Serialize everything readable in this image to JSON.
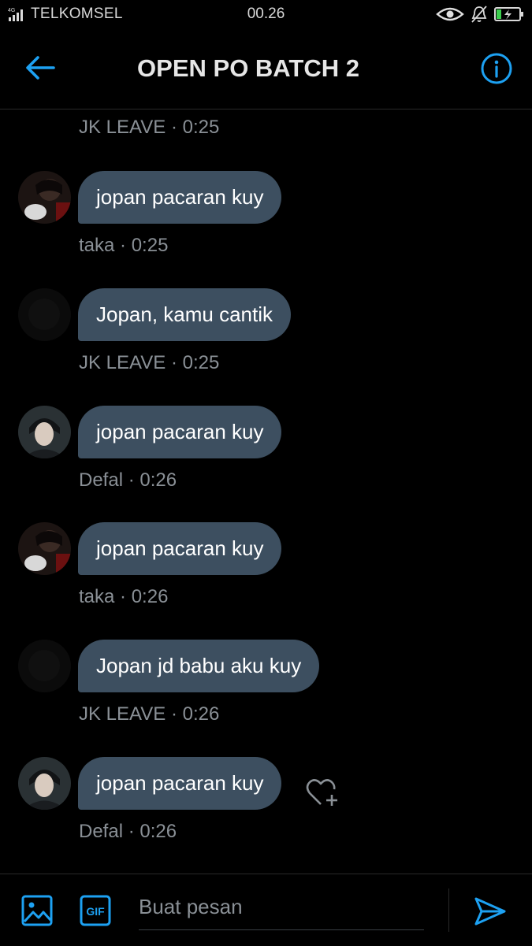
{
  "status_bar": {
    "network": "4G",
    "carrier": "TELKOMSEL",
    "time": "00.26",
    "icons": [
      "eye-comfort-icon",
      "bell-off-icon",
      "battery-charging-icon"
    ]
  },
  "header": {
    "title": "OPEN PO BATCH 2",
    "back_icon": "arrow-left-icon",
    "info_icon": "info-icon"
  },
  "messages": [
    {
      "avatar": "none",
      "text": "",
      "sender": "JK LEAVE",
      "time": "0:25"
    },
    {
      "avatar": "taka",
      "text": "jopan pacaran kuy",
      "sender": "taka",
      "time": "0:25"
    },
    {
      "avatar": "jkleave",
      "text": "Jopan, kamu cantik",
      "sender": "JK LEAVE",
      "time": "0:25"
    },
    {
      "avatar": "defal",
      "text": "jopan pacaran kuy",
      "sender": "Defal",
      "time": "0:26"
    },
    {
      "avatar": "taka",
      "text": "jopan pacaran kuy",
      "sender": "taka",
      "time": "0:26"
    },
    {
      "avatar": "jkleave",
      "text": "Jopan jd babu aku kuy",
      "sender": "JK LEAVE",
      "time": "0:26"
    },
    {
      "avatar": "defal",
      "text": "jopan pacaran kuy",
      "sender": "Defal",
      "time": "0:26",
      "reaction_icon": "heart-plus-icon"
    }
  ],
  "composer": {
    "placeholder": "Buat pesan",
    "value": "",
    "gif_label": "GIF",
    "image_icon": "image-icon",
    "send_icon": "send-icon"
  },
  "colors": {
    "background": "#000000",
    "bubble": "#3d4f60",
    "accent": "#1da1f2",
    "meta_text": "#8a9096"
  }
}
